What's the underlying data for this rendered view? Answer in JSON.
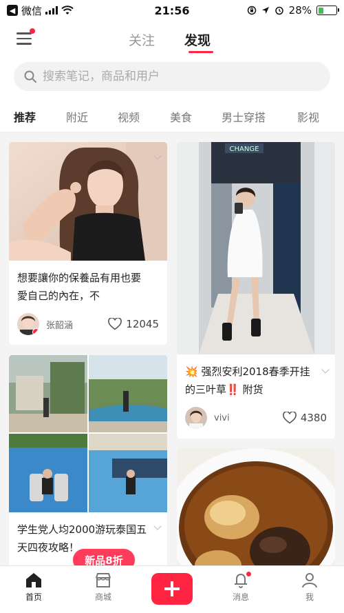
{
  "status_bar": {
    "carrier": "微信",
    "time": "21:56",
    "battery": "28%",
    "battery_level": 0.28
  },
  "header": {
    "tabs": [
      {
        "label": "关注",
        "active": false
      },
      {
        "label": "发现",
        "active": true
      }
    ]
  },
  "search": {
    "placeholder": "搜索笔记，商品和用户"
  },
  "categories": [
    {
      "label": "推荐",
      "active": true
    },
    {
      "label": "附近",
      "active": false
    },
    {
      "label": "视频",
      "active": false
    },
    {
      "label": "美食",
      "active": false
    },
    {
      "label": "男士穿搭",
      "active": false
    },
    {
      "label": "影视",
      "active": false
    }
  ],
  "feed": {
    "left": [
      {
        "title": "想要讓你的保養品有用也要愛自己的內在，不",
        "author": "张韶涵",
        "likes": "12045",
        "verified": true
      },
      {
        "title": "学生党人均2000游玩泰国五天四夜攻略！",
        "author": "",
        "likes": ""
      }
    ],
    "right": [
      {
        "title_prefix": "💥",
        "title": "强烈安利2018春季开挂的三叶草",
        "title_mark": "‼️",
        "title_suffix": "附货",
        "author": "vivi",
        "likes": "4380"
      },
      {
        "title": "",
        "author": "",
        "likes": ""
      }
    ]
  },
  "bottom_nav": {
    "items": [
      {
        "label": "首页",
        "icon": "home-icon",
        "active": true
      },
      {
        "label": "商城",
        "icon": "shop-icon",
        "active": false
      },
      {
        "label": "",
        "icon": "plus-icon",
        "active": false
      },
      {
        "label": "消息",
        "icon": "bell-icon",
        "active": false
      },
      {
        "label": "我",
        "icon": "user-icon",
        "active": false
      }
    ],
    "promo_badge": "新品8折"
  },
  "colors": {
    "accent": "#ff2442",
    "background": "#f4f4f4"
  }
}
